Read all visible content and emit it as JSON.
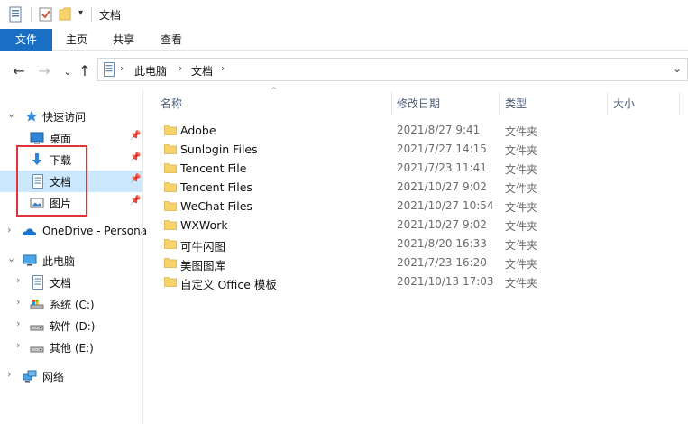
{
  "titlebar": {
    "title": "文档"
  },
  "ribbon": {
    "tabs": [
      "文件",
      "主页",
      "共享",
      "查看"
    ]
  },
  "address": {
    "crumbs": [
      "此电脑",
      "文档"
    ]
  },
  "navpane": {
    "quick_access": "快速访问",
    "quick_items": [
      {
        "label": "桌面",
        "icon": "desktop-icon"
      },
      {
        "label": "下载",
        "icon": "download-icon"
      },
      {
        "label": "文档",
        "icon": "document-icon"
      },
      {
        "label": "图片",
        "icon": "pictures-icon"
      }
    ],
    "onedrive": "OneDrive - Persona",
    "this_pc": "此电脑",
    "pc_items": [
      {
        "label": "文档",
        "icon": "document-icon"
      },
      {
        "label": "系统 (C:)",
        "icon": "drive-icon"
      },
      {
        "label": "软件 (D:)",
        "icon": "drive-icon"
      },
      {
        "label": "其他 (E:)",
        "icon": "drive-icon"
      }
    ],
    "network": "网络"
  },
  "columns": {
    "name": "名称",
    "date": "修改日期",
    "type": "类型",
    "size": "大小"
  },
  "files": [
    {
      "name": "Adobe",
      "date": "2021/8/27 9:41",
      "type": "文件夹"
    },
    {
      "name": "Sunlogin Files",
      "date": "2021/7/27 14:15",
      "type": "文件夹"
    },
    {
      "name": "Tencent File",
      "date": "2021/7/23 11:41",
      "type": "文件夹"
    },
    {
      "name": "Tencent Files",
      "date": "2021/10/27 9:02",
      "type": "文件夹"
    },
    {
      "name": "WeChat Files",
      "date": "2021/10/27 10:54",
      "type": "文件夹"
    },
    {
      "name": "WXWork",
      "date": "2021/10/27 9:02",
      "type": "文件夹"
    },
    {
      "name": "可牛闪图",
      "date": "2021/8/20 16:33",
      "type": "文件夹"
    },
    {
      "name": "美图图库",
      "date": "2021/7/23 16:20",
      "type": "文件夹"
    },
    {
      "name": "自定义 Office 模板",
      "date": "2021/10/13 17:03",
      "type": "文件夹"
    }
  ],
  "colors": {
    "accent": "#1a6fc4",
    "selection": "#cce8ff",
    "highlight_box": "#e0333c",
    "folder": "#f8d26a"
  }
}
